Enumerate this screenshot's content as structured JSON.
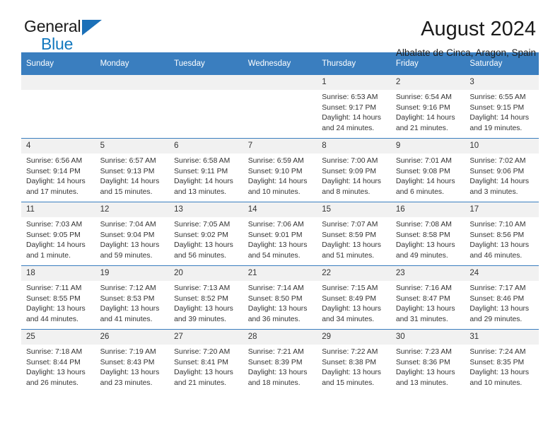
{
  "brand": {
    "name_top": "General",
    "name_bottom": "Blue",
    "accent_color": "#1b70b8"
  },
  "header": {
    "title": "August 2024",
    "subtitle": "Albalate de Cinca, Aragon, Spain"
  },
  "calendar": {
    "header_bg": "#3a7ebf",
    "daynum_bg": "#f1f1f1",
    "weekday_headers": [
      "Sunday",
      "Monday",
      "Tuesday",
      "Wednesday",
      "Thursday",
      "Friday",
      "Saturday"
    ],
    "weeks": [
      [
        {
          "day": "",
          "lines": []
        },
        {
          "day": "",
          "lines": []
        },
        {
          "day": "",
          "lines": []
        },
        {
          "day": "",
          "lines": []
        },
        {
          "day": "1",
          "lines": [
            "Sunrise: 6:53 AM",
            "Sunset: 9:17 PM",
            "Daylight: 14 hours",
            "and 24 minutes."
          ]
        },
        {
          "day": "2",
          "lines": [
            "Sunrise: 6:54 AM",
            "Sunset: 9:16 PM",
            "Daylight: 14 hours",
            "and 21 minutes."
          ]
        },
        {
          "day": "3",
          "lines": [
            "Sunrise: 6:55 AM",
            "Sunset: 9:15 PM",
            "Daylight: 14 hours",
            "and 19 minutes."
          ]
        }
      ],
      [
        {
          "day": "4",
          "lines": [
            "Sunrise: 6:56 AM",
            "Sunset: 9:14 PM",
            "Daylight: 14 hours",
            "and 17 minutes."
          ]
        },
        {
          "day": "5",
          "lines": [
            "Sunrise: 6:57 AM",
            "Sunset: 9:13 PM",
            "Daylight: 14 hours",
            "and 15 minutes."
          ]
        },
        {
          "day": "6",
          "lines": [
            "Sunrise: 6:58 AM",
            "Sunset: 9:11 PM",
            "Daylight: 14 hours",
            "and 13 minutes."
          ]
        },
        {
          "day": "7",
          "lines": [
            "Sunrise: 6:59 AM",
            "Sunset: 9:10 PM",
            "Daylight: 14 hours",
            "and 10 minutes."
          ]
        },
        {
          "day": "8",
          "lines": [
            "Sunrise: 7:00 AM",
            "Sunset: 9:09 PM",
            "Daylight: 14 hours",
            "and 8 minutes."
          ]
        },
        {
          "day": "9",
          "lines": [
            "Sunrise: 7:01 AM",
            "Sunset: 9:08 PM",
            "Daylight: 14 hours",
            "and 6 minutes."
          ]
        },
        {
          "day": "10",
          "lines": [
            "Sunrise: 7:02 AM",
            "Sunset: 9:06 PM",
            "Daylight: 14 hours",
            "and 3 minutes."
          ]
        }
      ],
      [
        {
          "day": "11",
          "lines": [
            "Sunrise: 7:03 AM",
            "Sunset: 9:05 PM",
            "Daylight: 14 hours",
            "and 1 minute."
          ]
        },
        {
          "day": "12",
          "lines": [
            "Sunrise: 7:04 AM",
            "Sunset: 9:04 PM",
            "Daylight: 13 hours",
            "and 59 minutes."
          ]
        },
        {
          "day": "13",
          "lines": [
            "Sunrise: 7:05 AM",
            "Sunset: 9:02 PM",
            "Daylight: 13 hours",
            "and 56 minutes."
          ]
        },
        {
          "day": "14",
          "lines": [
            "Sunrise: 7:06 AM",
            "Sunset: 9:01 PM",
            "Daylight: 13 hours",
            "and 54 minutes."
          ]
        },
        {
          "day": "15",
          "lines": [
            "Sunrise: 7:07 AM",
            "Sunset: 8:59 PM",
            "Daylight: 13 hours",
            "and 51 minutes."
          ]
        },
        {
          "day": "16",
          "lines": [
            "Sunrise: 7:08 AM",
            "Sunset: 8:58 PM",
            "Daylight: 13 hours",
            "and 49 minutes."
          ]
        },
        {
          "day": "17",
          "lines": [
            "Sunrise: 7:10 AM",
            "Sunset: 8:56 PM",
            "Daylight: 13 hours",
            "and 46 minutes."
          ]
        }
      ],
      [
        {
          "day": "18",
          "lines": [
            "Sunrise: 7:11 AM",
            "Sunset: 8:55 PM",
            "Daylight: 13 hours",
            "and 44 minutes."
          ]
        },
        {
          "day": "19",
          "lines": [
            "Sunrise: 7:12 AM",
            "Sunset: 8:53 PM",
            "Daylight: 13 hours",
            "and 41 minutes."
          ]
        },
        {
          "day": "20",
          "lines": [
            "Sunrise: 7:13 AM",
            "Sunset: 8:52 PM",
            "Daylight: 13 hours",
            "and 39 minutes."
          ]
        },
        {
          "day": "21",
          "lines": [
            "Sunrise: 7:14 AM",
            "Sunset: 8:50 PM",
            "Daylight: 13 hours",
            "and 36 minutes."
          ]
        },
        {
          "day": "22",
          "lines": [
            "Sunrise: 7:15 AM",
            "Sunset: 8:49 PM",
            "Daylight: 13 hours",
            "and 34 minutes."
          ]
        },
        {
          "day": "23",
          "lines": [
            "Sunrise: 7:16 AM",
            "Sunset: 8:47 PM",
            "Daylight: 13 hours",
            "and 31 minutes."
          ]
        },
        {
          "day": "24",
          "lines": [
            "Sunrise: 7:17 AM",
            "Sunset: 8:46 PM",
            "Daylight: 13 hours",
            "and 29 minutes."
          ]
        }
      ],
      [
        {
          "day": "25",
          "lines": [
            "Sunrise: 7:18 AM",
            "Sunset: 8:44 PM",
            "Daylight: 13 hours",
            "and 26 minutes."
          ]
        },
        {
          "day": "26",
          "lines": [
            "Sunrise: 7:19 AM",
            "Sunset: 8:43 PM",
            "Daylight: 13 hours",
            "and 23 minutes."
          ]
        },
        {
          "day": "27",
          "lines": [
            "Sunrise: 7:20 AM",
            "Sunset: 8:41 PM",
            "Daylight: 13 hours",
            "and 21 minutes."
          ]
        },
        {
          "day": "28",
          "lines": [
            "Sunrise: 7:21 AM",
            "Sunset: 8:39 PM",
            "Daylight: 13 hours",
            "and 18 minutes."
          ]
        },
        {
          "day": "29",
          "lines": [
            "Sunrise: 7:22 AM",
            "Sunset: 8:38 PM",
            "Daylight: 13 hours",
            "and 15 minutes."
          ]
        },
        {
          "day": "30",
          "lines": [
            "Sunrise: 7:23 AM",
            "Sunset: 8:36 PM",
            "Daylight: 13 hours",
            "and 13 minutes."
          ]
        },
        {
          "day": "31",
          "lines": [
            "Sunrise: 7:24 AM",
            "Sunset: 8:35 PM",
            "Daylight: 13 hours",
            "and 10 minutes."
          ]
        }
      ]
    ]
  }
}
